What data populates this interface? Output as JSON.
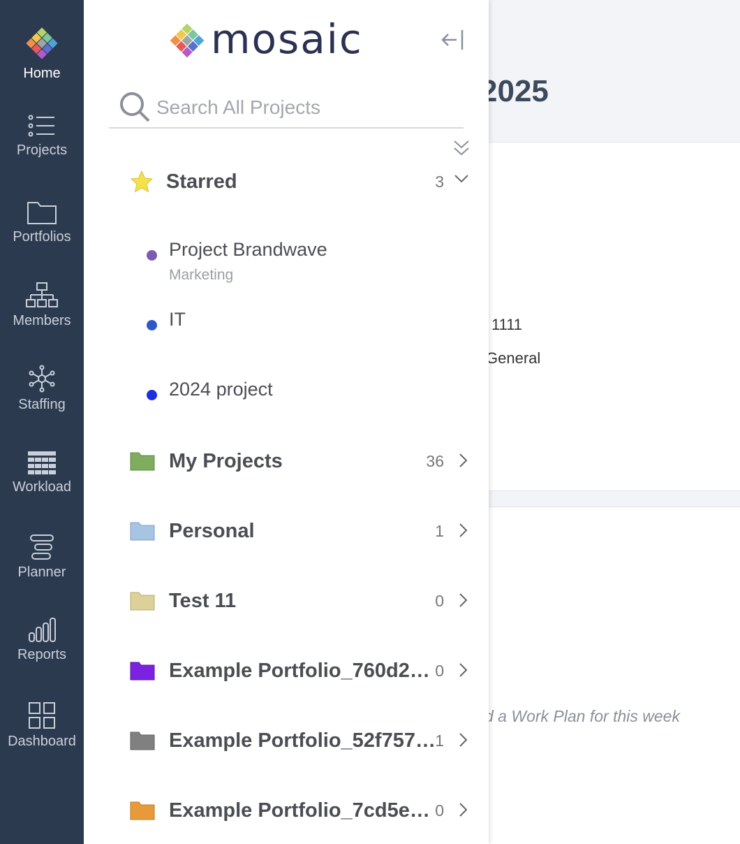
{
  "rail": {
    "items": [
      {
        "label": "Home",
        "icon": "mosaic-logo-icon"
      },
      {
        "label": "Projects",
        "icon": "list-icon"
      },
      {
        "label": "Portfolios",
        "icon": "folder-icon"
      },
      {
        "label": "Members",
        "icon": "org-chart-icon"
      },
      {
        "label": "Staffing",
        "icon": "network-icon"
      },
      {
        "label": "Workload",
        "icon": "grid-icon"
      },
      {
        "label": "Planner",
        "icon": "planner-icon"
      },
      {
        "label": "Reports",
        "icon": "bar-chart-icon"
      },
      {
        "label": "Dashboard",
        "icon": "dashboard-icon"
      }
    ]
  },
  "drawer": {
    "logo_text": "mosaic",
    "search": {
      "placeholder": "Search All Projects",
      "value": ""
    },
    "starred": {
      "label": "Starred",
      "count": "3",
      "color": "#f5e14a"
    },
    "starred_projects": [
      {
        "name": "Project Brandwave",
        "sub": "Marketing",
        "color": "#7b5cb0"
      },
      {
        "name": "IT",
        "sub": "",
        "color": "#2d58c9"
      },
      {
        "name": "2024 project",
        "sub": "",
        "color": "#1a2fe0"
      }
    ],
    "groups": [
      {
        "label": "My Projects",
        "count": "36",
        "color": "#7fad5f"
      },
      {
        "label": "Personal",
        "count": "1",
        "color": "#a8c4e3"
      },
      {
        "label": "Test 11",
        "count": "0",
        "color": "#ddd19a"
      },
      {
        "label": "Example Portfolio_760d2b...",
        "count": "0",
        "color": "#7a22e0"
      },
      {
        "label": "Example Portfolio_52f7570...",
        "count": "1",
        "color": "#808080"
      },
      {
        "label": "Example Portfolio_7cd5e49...",
        "count": "0",
        "color": "#e69a3a"
      }
    ]
  },
  "main": {
    "title": "2025",
    "line1": "1111",
    "line2": "General",
    "note": "d a Work Plan for this week"
  }
}
